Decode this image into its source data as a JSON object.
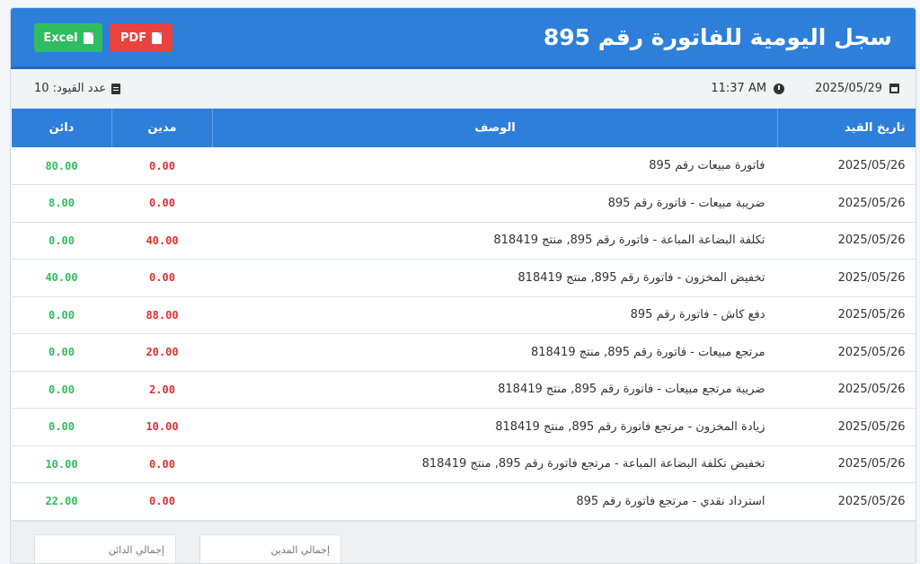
{
  "header": {
    "title": "سجل اليومية للفاتورة رقم 895",
    "excel_label": "Excel",
    "pdf_label": "PDF",
    "colors": {
      "primary": "#2e7fd9",
      "excel": "#2fbd5f",
      "pdf": "#e9423f"
    }
  },
  "info": {
    "date": "2025/05/29",
    "time": "11:37 AM",
    "entries_count": "عدد القيود: 10"
  },
  "table": {
    "headers": {
      "date": "تاريخ القيد",
      "description": "الوصف",
      "debit": "مدين",
      "credit": "دائن"
    },
    "rows": [
      {
        "date": "2025/05/26",
        "description": "فاتورة مبيعات رقم 895",
        "debit": "0.00",
        "credit": "80.00"
      },
      {
        "date": "2025/05/26",
        "description": "ضريبة مبيعات - فاتورة رقم 895",
        "debit": "0.00",
        "credit": "8.00"
      },
      {
        "date": "2025/05/26",
        "description": "تكلفة البضاعة المباعة - فاتورة رقم 895, منتج 818419",
        "debit": "40.00",
        "credit": "0.00"
      },
      {
        "date": "2025/05/26",
        "description": "تخفيض المخزون - فاتورة رقم 895, منتج 818419",
        "debit": "0.00",
        "credit": "40.00"
      },
      {
        "date": "2025/05/26",
        "description": "دفع كاش - فاتورة رقم 895",
        "debit": "88.00",
        "credit": "0.00"
      },
      {
        "date": "2025/05/26",
        "description": "مرتجع مبيعات - فاتورة رقم 895, منتج 818419",
        "debit": "20.00",
        "credit": "0.00"
      },
      {
        "date": "2025/05/26",
        "description": "ضريبة مرتجع مبيعات - فاتورة رقم 895, منتج 818419",
        "debit": "2.00",
        "credit": "0.00"
      },
      {
        "date": "2025/05/26",
        "description": "زيادة المخزون - مرتجع فاتورة رقم 895, منتج 818419",
        "debit": "10.00",
        "credit": "0.00"
      },
      {
        "date": "2025/05/26",
        "description": "تخفيض تكلفة البضاعة المباعة - مرتجع فاتورة رقم 895, منتج 818419",
        "debit": "0.00",
        "credit": "10.00"
      },
      {
        "date": "2025/05/26",
        "description": "استرداد نقدي - مرتجع فاتورة رقم 895",
        "debit": "0.00",
        "credit": "22.00"
      }
    ]
  },
  "footer": {
    "total_debit_label": "إجمالي المدين",
    "total_credit_label": "إجمالي الدائن"
  }
}
